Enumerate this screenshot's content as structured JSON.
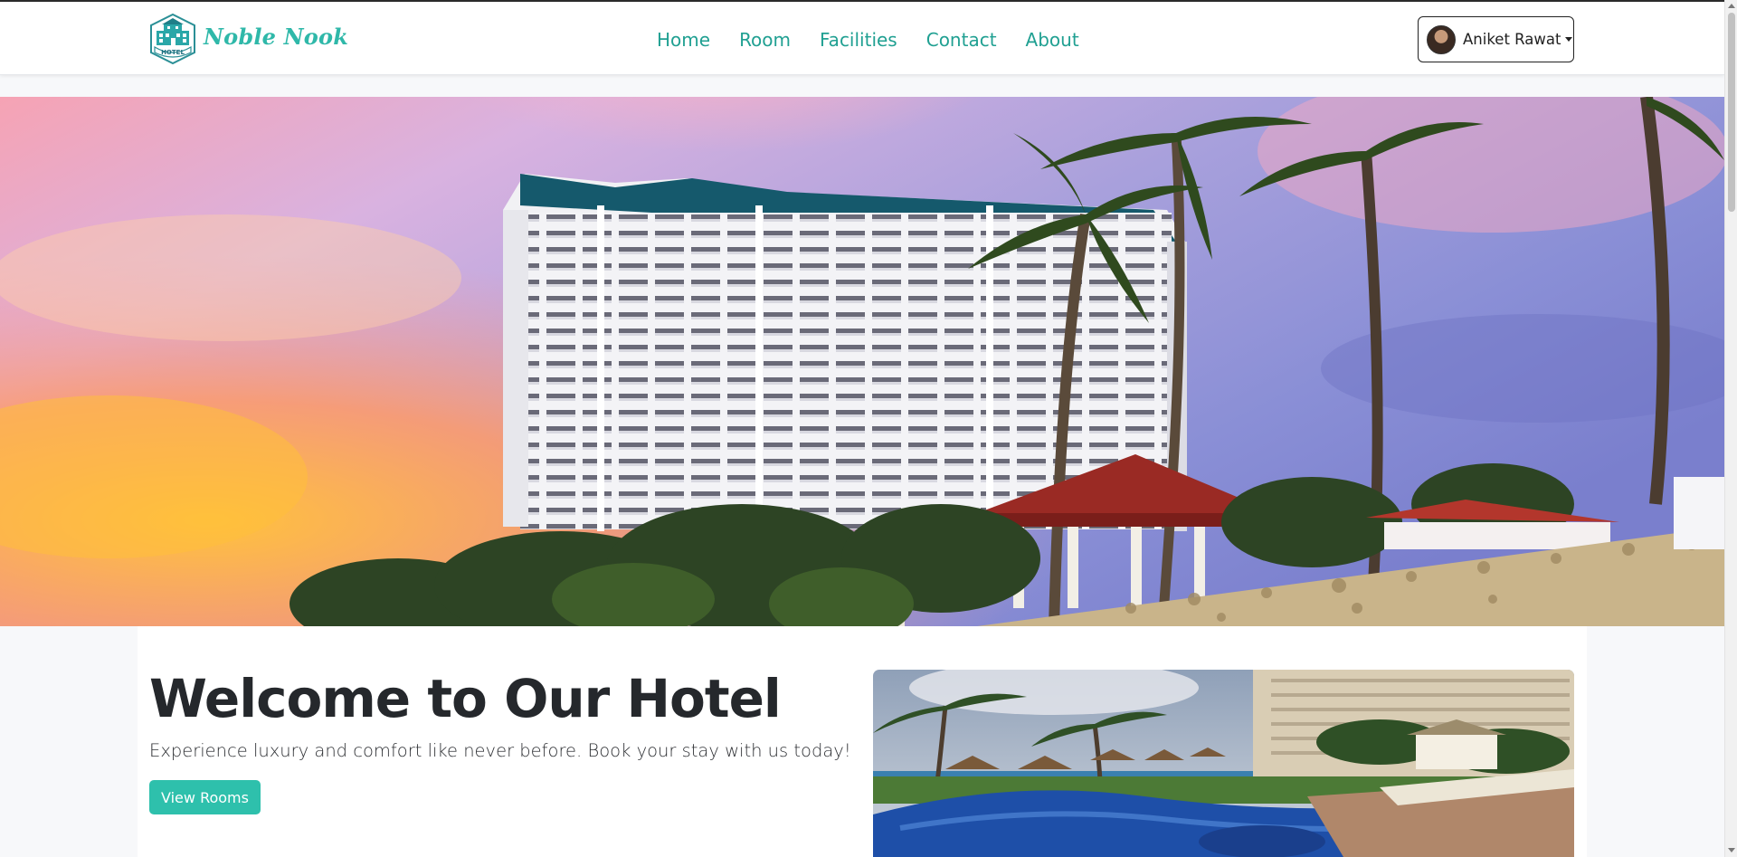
{
  "brand": {
    "name": "Noble Nook",
    "logo_text": "HOTEL",
    "logo_icon": "hotel-building-icon"
  },
  "nav": {
    "links": [
      "Home",
      "Room",
      "Facilities",
      "Contact",
      "About"
    ]
  },
  "user": {
    "name": "Aniket Rawat",
    "caret_icon": "caret-down-icon"
  },
  "hero": {
    "image": "hotel-building-beach-sunset"
  },
  "main": {
    "title": "Welcome to Our Hotel",
    "subtitle": "Experience luxury and comfort like never before. Book your stay with us today!",
    "cta_label": "View Rooms",
    "side_image": "resort-pool-and-palm-trees"
  },
  "colors": {
    "accent": "#2ec0ac",
    "nav_link": "#20a092",
    "heading": "#25282c",
    "page_bg": "#f7f8fa"
  }
}
